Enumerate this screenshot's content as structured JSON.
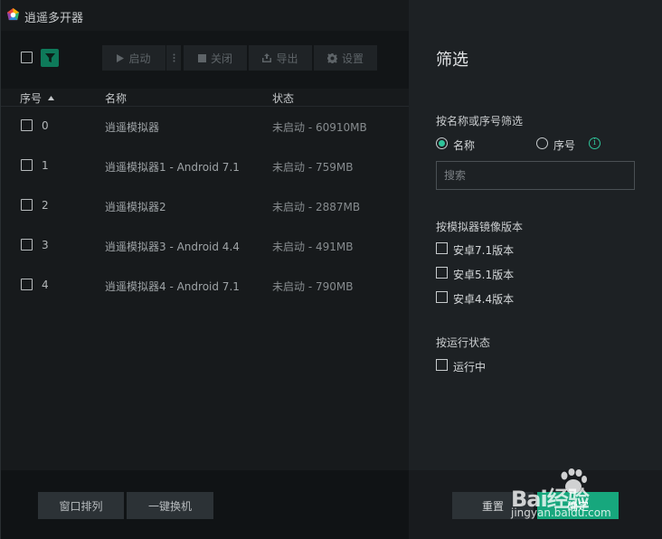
{
  "app": {
    "title": "逍遥多开器"
  },
  "toolbar": {
    "start_label": "启动",
    "close_label": "关闭",
    "export_label": "导出",
    "settings_label": "设置",
    "filter_icon": "filter-icon"
  },
  "columns": {
    "index": "序号",
    "name": "名称",
    "status": "状态"
  },
  "rows": [
    {
      "index": "0",
      "name": "逍遥模拟器",
      "status": "未启动 - 60910MB"
    },
    {
      "index": "1",
      "name": "逍遥模拟器1 - Android 7.1",
      "status": "未启动 - 759MB"
    },
    {
      "index": "2",
      "name": "逍遥模拟器2",
      "status": "未启动 - 2887MB"
    },
    {
      "index": "3",
      "name": "逍遥模拟器3 - Android 4.4",
      "status": "未启动 - 491MB"
    },
    {
      "index": "4",
      "name": "逍遥模拟器4 - Android 7.1",
      "status": "未启动 - 790MB"
    }
  ],
  "bottom": {
    "arrange_label": "窗口排列",
    "switch_label": "一键换机"
  },
  "filter_panel": {
    "title": "筛选",
    "by_name_section": "按名称或序号筛选",
    "radio_name": "名称",
    "radio_index": "序号",
    "search_placeholder": "搜索",
    "by_version_section": "按模拟器镜像版本",
    "versions": [
      "安卓7.1版本",
      "安卓5.1版本",
      "安卓4.4版本"
    ],
    "by_state_section": "按运行状态",
    "states": [
      "运行中"
    ],
    "reset_label": "重置",
    "ok_label": "确定",
    "accent_color": "#17a77d"
  },
  "watermark": {
    "brand": "Bai经验",
    "url": "jingyan.baidu.com"
  }
}
